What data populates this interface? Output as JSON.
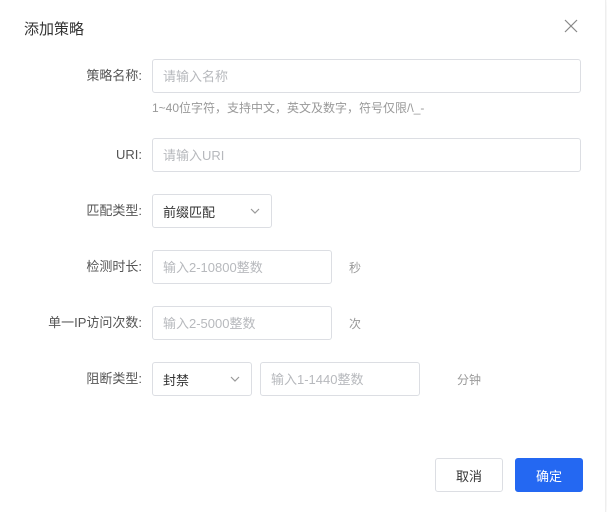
{
  "dialog": {
    "title": "添加策略"
  },
  "form": {
    "name": {
      "label": "策略名称:",
      "placeholder": "请输入名称",
      "hint": "1~40位字符，支持中文，英文及数字，符号仅限/\\_-"
    },
    "uri": {
      "label": "URI:",
      "placeholder": "请输入URI"
    },
    "matchType": {
      "label": "匹配类型:",
      "value": "前缀匹配"
    },
    "detectDuration": {
      "label": "检测时长:",
      "placeholder": "输入2-10800整数",
      "suffix": "秒"
    },
    "ipCount": {
      "label": "单一IP访问次数:",
      "placeholder": "输入2-5000整数",
      "suffix": "次"
    },
    "blockType": {
      "label": "阻断类型:",
      "value": "封禁",
      "durationPlaceholder": "输入1-1440整数",
      "durationSuffix": "分钟"
    }
  },
  "buttons": {
    "cancel": "取消",
    "confirm": "确定"
  }
}
